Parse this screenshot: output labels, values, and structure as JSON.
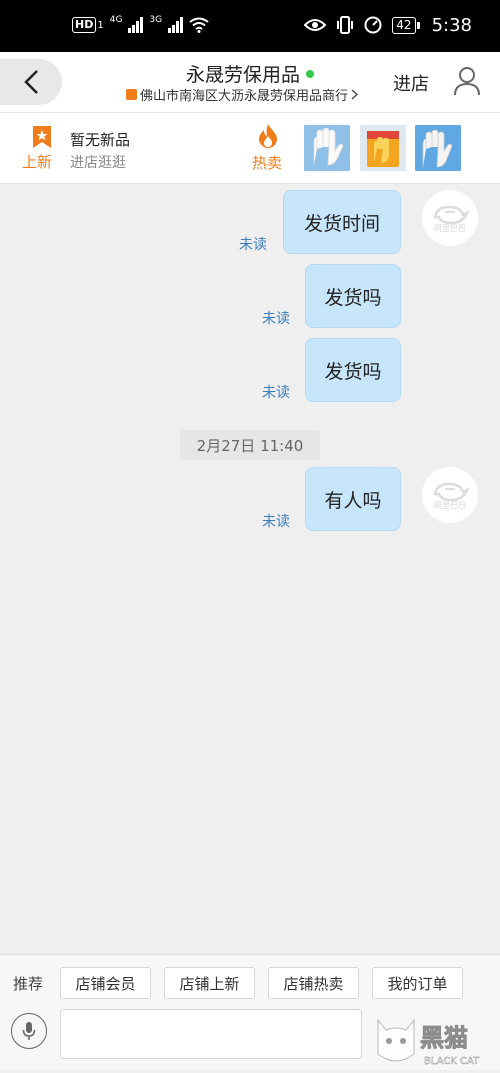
{
  "status_bar": {
    "network_badge": "HD",
    "network_sub": "1",
    "signal1_label": "4G",
    "signal2_label": "3G",
    "battery": "42",
    "time": "5:38"
  },
  "header": {
    "shop_name": "永晟劳保用品",
    "shop_subtitle": "佛山市南海区大沥永晟劳保用品商行",
    "enter_shop": "进店"
  },
  "promo": {
    "new_label": "上新",
    "no_new_title": "暂无新品",
    "browse_text": "进店逛逛",
    "hot_label": "热卖",
    "thumb_colors": [
      "#7fb3e0",
      "#f3a51f",
      "#5fa8e3"
    ]
  },
  "chat": {
    "avatar_text": "阿里巴巴",
    "timestamp": "2月27日 11:40",
    "messages": [
      {
        "text": "发货时间",
        "status": "未读"
      },
      {
        "text": "发货吗",
        "status": "未读"
      },
      {
        "text": "发货吗",
        "status": "未读"
      },
      {
        "text": "有人吗",
        "status": "未读"
      }
    ]
  },
  "bottom": {
    "recommend_label": "推荐",
    "chips": [
      "店铺会员",
      "店铺上新",
      "店铺热卖",
      "我的订单"
    ]
  },
  "watermark": {
    "brand": "黑猫",
    "brand_en": "BLACK CAT"
  },
  "colors": {
    "accent_orange": "#f07d1a",
    "bubble": "#c8e6fb",
    "unread": "#3b7dbb",
    "online": "#33c94a"
  }
}
